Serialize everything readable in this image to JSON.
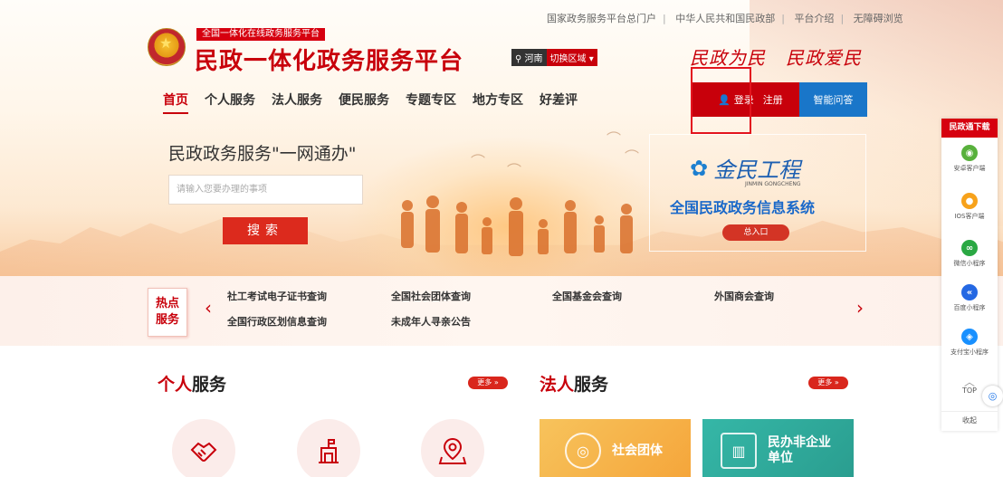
{
  "top_links": [
    "国家政务服务平台总门户",
    "中华人民共和国民政部",
    "平台介绍",
    "无障碍浏览"
  ],
  "logo": {
    "tag": "全国一体化在线政务服务平台",
    "title": "民政一体化政务服务平台"
  },
  "region": {
    "location": "河南",
    "switch_label": "切换区域"
  },
  "slogan": [
    "民政为民",
    "民政爱民"
  ],
  "nav": [
    "首页",
    "个人服务",
    "法人服务",
    "便民服务",
    "专题专区",
    "地方专区",
    "好差评"
  ],
  "auth": {
    "login": "登录",
    "register": "注册",
    "qa": "智能问答"
  },
  "search": {
    "title": "民政政务服务\"一网通办\"",
    "placeholder": "请输入您要办理的事项",
    "button": "搜索"
  },
  "jinmin": {
    "logo_text": "金民工程",
    "logo_sub": "JINMIN GONGCHENG",
    "title": "全国民政政务信息系统",
    "entry": "总入口"
  },
  "hot": {
    "badge_line1": "热点",
    "badge_line2": "服务",
    "items_row1": [
      "社工考试电子证书查询",
      "全国社会团体查询",
      "全国基金会查询",
      "外国商会查询"
    ],
    "items_row2": [
      "全国行政区划信息查询",
      "未成年人寻亲公告"
    ]
  },
  "sections": {
    "personal": {
      "title_red": "个人",
      "title_rest": "服务",
      "more": "更多 »"
    },
    "legal": {
      "title_red": "法人",
      "title_rest": "服务",
      "more": "更多 »",
      "card1": "社会团体",
      "card2_line1": "民办非企业",
      "card2_line2": "单位"
    }
  },
  "sidebar": {
    "header": "民政通下载",
    "items": [
      {
        "label": "安卓客户端",
        "color": "#58b13c"
      },
      {
        "label": "IOS客户端",
        "color": "#f7a21b"
      },
      {
        "label": "微信小程序",
        "color": "#2aa843"
      },
      {
        "label": "百度小程序",
        "color": "#2468e3"
      },
      {
        "label": "支付宝小程序",
        "color": "#1890ff"
      }
    ],
    "top": "TOP",
    "fold": "收起"
  },
  "colors": {
    "brand_red": "#c8000b",
    "accent_blue": "#1976c9"
  }
}
